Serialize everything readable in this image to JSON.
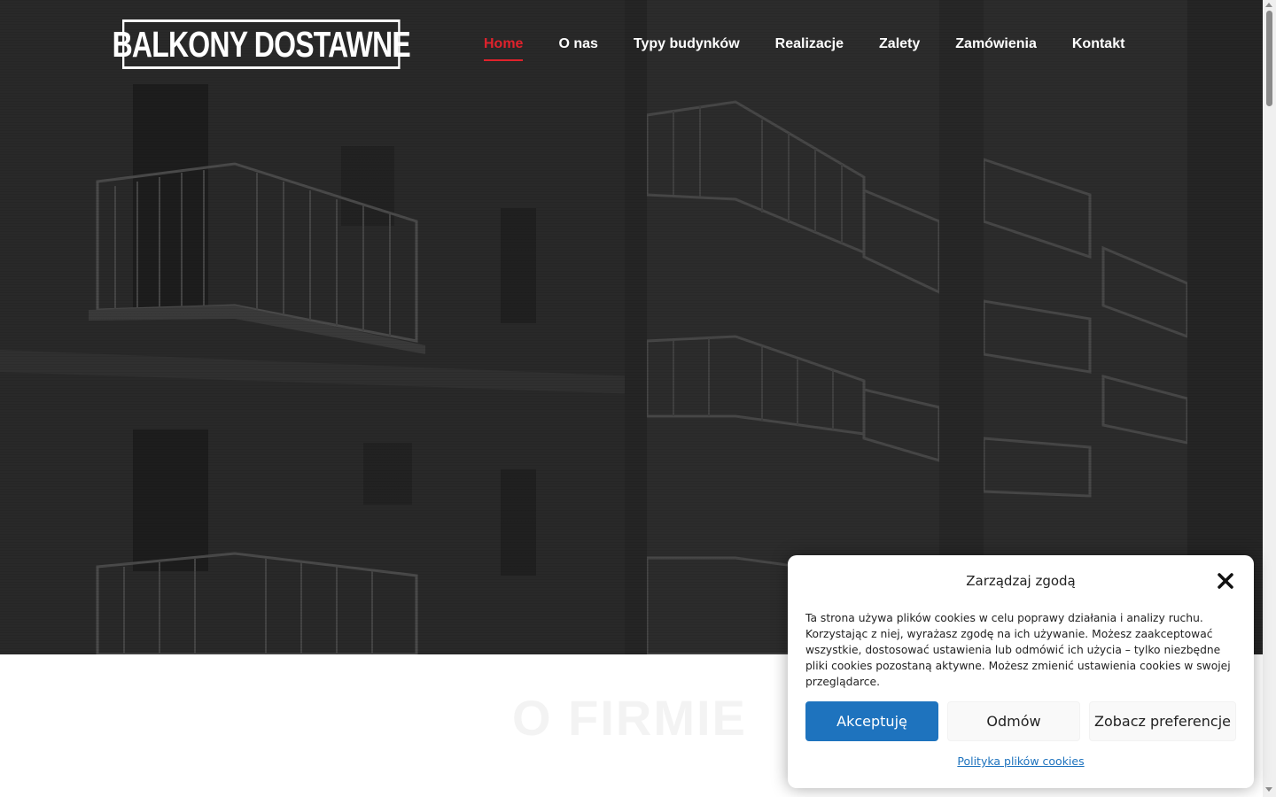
{
  "header": {
    "logo_text": "BALKONY DOSTAWNE",
    "nav": [
      {
        "label": "Home",
        "active": true
      },
      {
        "label": "O nas"
      },
      {
        "label": "Typy budynków"
      },
      {
        "label": "Realizacje"
      },
      {
        "label": "Zalety"
      },
      {
        "label": "Zamówienia"
      },
      {
        "label": "Kontakt"
      }
    ]
  },
  "section": {
    "title": "O FIRMIE"
  },
  "cookie_dialog": {
    "title": "Zarządzaj zgodą",
    "close_icon": "close-icon",
    "text": "Ta strona używa plików cookies w celu poprawy działania i analizy ruchu. Korzystając z niej, wyrażasz zgodę na ich używanie. Możesz zaakceptować wszystkie, dostosować ustawienia lub odmówić ich użycia – tylko niezbędne pliki cookies pozostaną aktywne. Możesz zmienić ustawienia cookies w swojej przeglądarce.",
    "accept_label": "Akceptuję",
    "deny_label": "Odmów",
    "preferences_label": "Zobacz preferencje",
    "policy_link": "Polityka plików cookies"
  },
  "colors": {
    "accent": "#e0222c",
    "button_primary": "#1e73be",
    "hero_bg": "#2a2a2a"
  }
}
